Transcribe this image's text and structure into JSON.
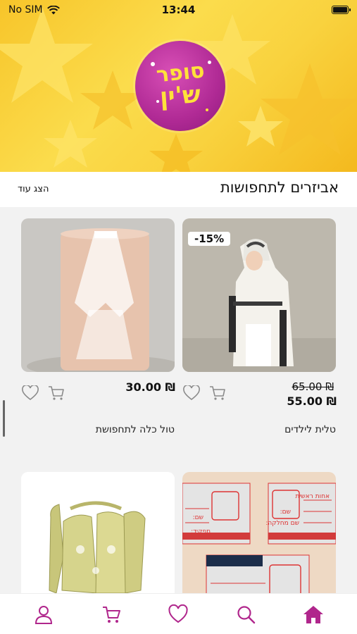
{
  "status_bar": {
    "carrier": "No SIM",
    "time": "13:44"
  },
  "banner": {
    "logo_text_top": "סופר",
    "logo_text_bottom": "ש'ין"
  },
  "section": {
    "title": "אביזרים לתחפושות",
    "show_more": "הצג עוד"
  },
  "products": [
    {
      "name": "טלית לילדים",
      "old_price": "₪ 65.00",
      "new_price": "₪ 55.00",
      "discount_badge": "-15%"
    },
    {
      "name": "טול כלה לתחפושת",
      "new_price": "₪ 30.00"
    },
    {
      "name": ""
    },
    {
      "name": ""
    }
  ],
  "card3_form": {
    "field1": "אחות ראשית",
    "field2": "שם:",
    "field3": "שם מחלקה:",
    "field4": "שם:",
    "field5": "תפקיד:"
  },
  "tabs": [
    "home-icon",
    "search-icon",
    "heart-icon",
    "cart-icon",
    "profile-icon"
  ],
  "colors": {
    "accent": "#b0268c",
    "banner_yellow": "#f9d23e",
    "logo_purple": "#b02a95"
  }
}
